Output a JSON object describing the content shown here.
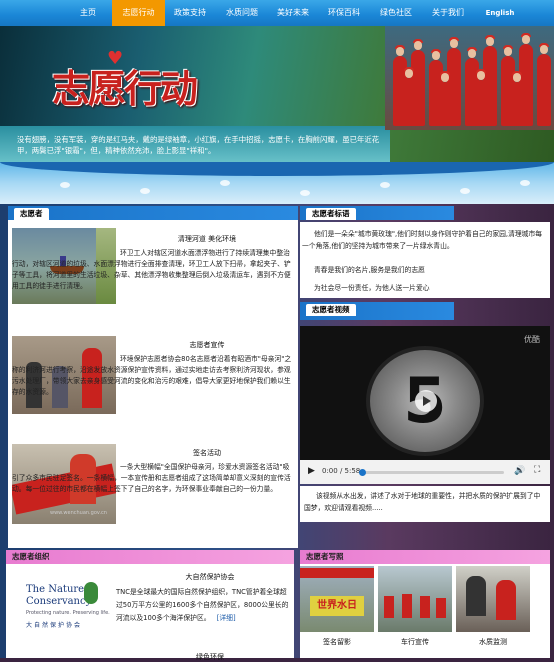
{
  "nav": {
    "items": [
      "主页",
      "志愿行动",
      "政策支持",
      "水质问题",
      "美好未来",
      "环保百科",
      "绿色社区",
      "关于我们",
      "English"
    ],
    "active_index": 1
  },
  "banner": {
    "logo_text": "志愿行动",
    "slogan": "没有翅膀，没有军装，穿的是红马夹，戴的是绿袖章，小红旗，在手中招摇，志愿卡，在胸前闪耀，虽已年近花甲，两鬓已浮\"银霜\"，但，精神依然充沛，脸上影显\"祥和\"。"
  },
  "volunteer": {
    "header": "志愿者",
    "entries": [
      {
        "title": "清理河道 美化环境",
        "body": "环卫工人对辖区河道水面漂浮物进行了持续清理集中整治行动，对辖区河道的垃圾、水面漂浮物进行全面排查清理，环卫工人放下扫帚，拿起夹子、铲子等工具，将河道里的生活垃圾、杂草、其他漂浮物收集整理后倒入垃圾清运车，遇到不方便用工具的徒手进行清理。"
      },
      {
        "title": "志愿者宣传",
        "body": "环境保护志愿者协会80名志愿者沿着有昭酒市\"母亲河\"之称的利济河进行考察，沿途发放水资源保护宣传资料，通过实地走访去考察利济河现状，参观污水处理厂，带领大家去亲身感受河流的变化和治污的艰难，倡导大家更好地保护我们赖以生存的水资源。"
      },
      {
        "title": "签名活动",
        "body": "一条大型横幅\"全国保护母亲河，珍爱水资源签名活动\"吸引了众多市民驻足签名。一条横幅，一本宣传册和志愿者组成了这场简单却意义深刻的宣传活动。每一位过往的市民都在横幅上签下了自己的名字，为环保事业奉献自己的一份力量。",
        "watermark": "www.wenchuan.gov.cn"
      }
    ]
  },
  "motto": {
    "header": "志愿者标语",
    "lines": [
      "他们是一朵朵\"城市黄玫瑰\",他们时刻以身作则守护着自己的家园,清理城市每一个角落,他们的坚持为城市带来了一片绿水青山。",
      "青春是我们的名片,服务是我们的志愿",
      "为社会尽一份责任，为他人送一片爱心"
    ]
  },
  "video": {
    "header": "志愿者视频",
    "brand": "优酷",
    "countdown": "5",
    "time": "0:00 / 5:58",
    "progress": 0,
    "caption": "该视频从水出发，讲述了水对于地球的重要性，并把水质的保护扩展到了中国梦，欢迎请观看视频....."
  },
  "org": {
    "header": "志愿者组织",
    "logo_line1": "The Nature",
    "logo_line2": "Conservancy",
    "logo_tagline": "Protecting nature. Preserving life.",
    "logo_cn": "大自然保护协会",
    "title": "大自然保护协会",
    "body": "TNC是全球最大的国际自然保护组织，TNC管护着全球超过50万平方公里的1600多个自然保护区，8000公里长的河流以及100多个海洋保护区。",
    "more": "[详细]",
    "next_title": "绿色环保"
  },
  "photos": {
    "header": "志愿者写照",
    "items": [
      {
        "caption": "签名留影",
        "banner_text": "世界水日"
      },
      {
        "caption": "车行宣传"
      },
      {
        "caption": "水质监测"
      }
    ]
  },
  "colors": {
    "nav_blue": "#1a86d6",
    "nav_active": "#f39800",
    "panel_header_blue": "#1a73c8",
    "panel_header_pink": "#e87bd0",
    "logo_red": "#c8211e"
  }
}
